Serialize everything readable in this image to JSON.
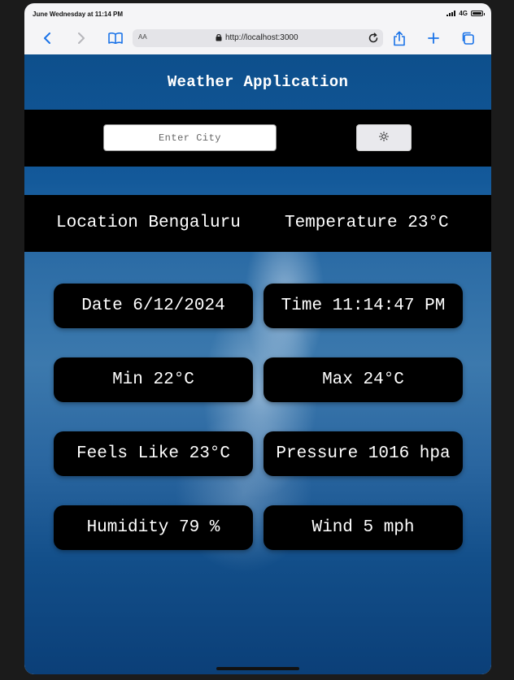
{
  "status_bar": {
    "time": "June Wednesday at 11:14 PM",
    "network": "4G"
  },
  "browser": {
    "text_size_label": "AA",
    "url": "http://localhost:3000"
  },
  "app": {
    "title": "Weather Application",
    "search": {
      "placeholder": "Enter City",
      "value": "",
      "button_icon": "sun-icon"
    },
    "summary": {
      "location": "Location Bengaluru",
      "temperature": "Temperature 23°C"
    },
    "cards": {
      "date": "Date 6/12/2024",
      "time": "Time 11:14:47 PM",
      "min": "Min 22°C",
      "max": "Max 24°C",
      "feels_like": "Feels Like 23°C",
      "pressure": "Pressure 1016 hpa",
      "humidity": "Humidity 79 %",
      "wind": "Wind 5 mph"
    }
  },
  "colors": {
    "panel": "#000000",
    "text": "#ffffff",
    "browser_accent": "#1a73e8",
    "sky": "#2d6da6"
  }
}
